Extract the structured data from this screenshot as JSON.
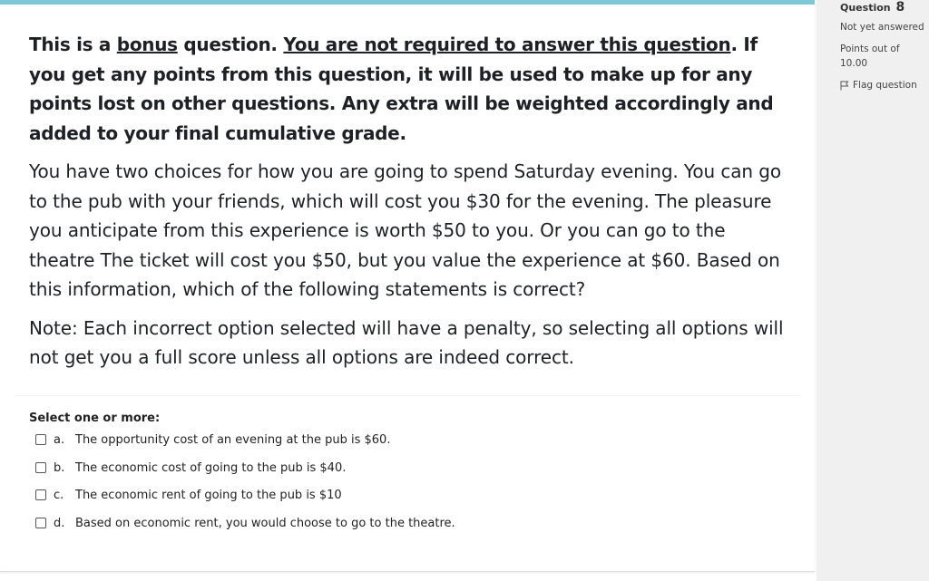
{
  "sidebar": {
    "question_label": "Question",
    "question_number": "8",
    "status": "Not yet answered",
    "points_label": "Points out of",
    "points_value": "10.00",
    "flag_label": "Flag question"
  },
  "question": {
    "intro_part1": "This is a ",
    "intro_bonus": "bonus",
    "intro_part2": " question. ",
    "intro_not_required": "You are not required to answer this question",
    "intro_part3": ". If you get any points from this question, it will be used to make up for any points lost on other questions. Any extra will be weighted accordingly and added to your final cumulative grade.",
    "scenario": "You have two choices for how you are going to spend Saturday evening. You can go to the pub with your friends, which will cost you $30 for the evening. The pleasure you anticipate from this experience is worth $50 to you. Or you can go to the theatre The ticket will cost you $50, but you value the experience at $60. Based on this information, which of the following statements is correct?",
    "note": "Note: Each incorrect option selected will have a penalty, so selecting all options will not get you a full score unless all options are indeed correct."
  },
  "answer": {
    "prompt": "Select one or more:",
    "options": [
      {
        "letter": "a.",
        "text": "The opportunity cost of an evening at the pub is $60."
      },
      {
        "letter": "b.",
        "text": "The economic cost of going to the pub is $40."
      },
      {
        "letter": "c.",
        "text": "The economic rent of going to the pub is $10"
      },
      {
        "letter": "d.",
        "text": "Based on economic rent, you would choose to go to the theatre."
      }
    ]
  }
}
